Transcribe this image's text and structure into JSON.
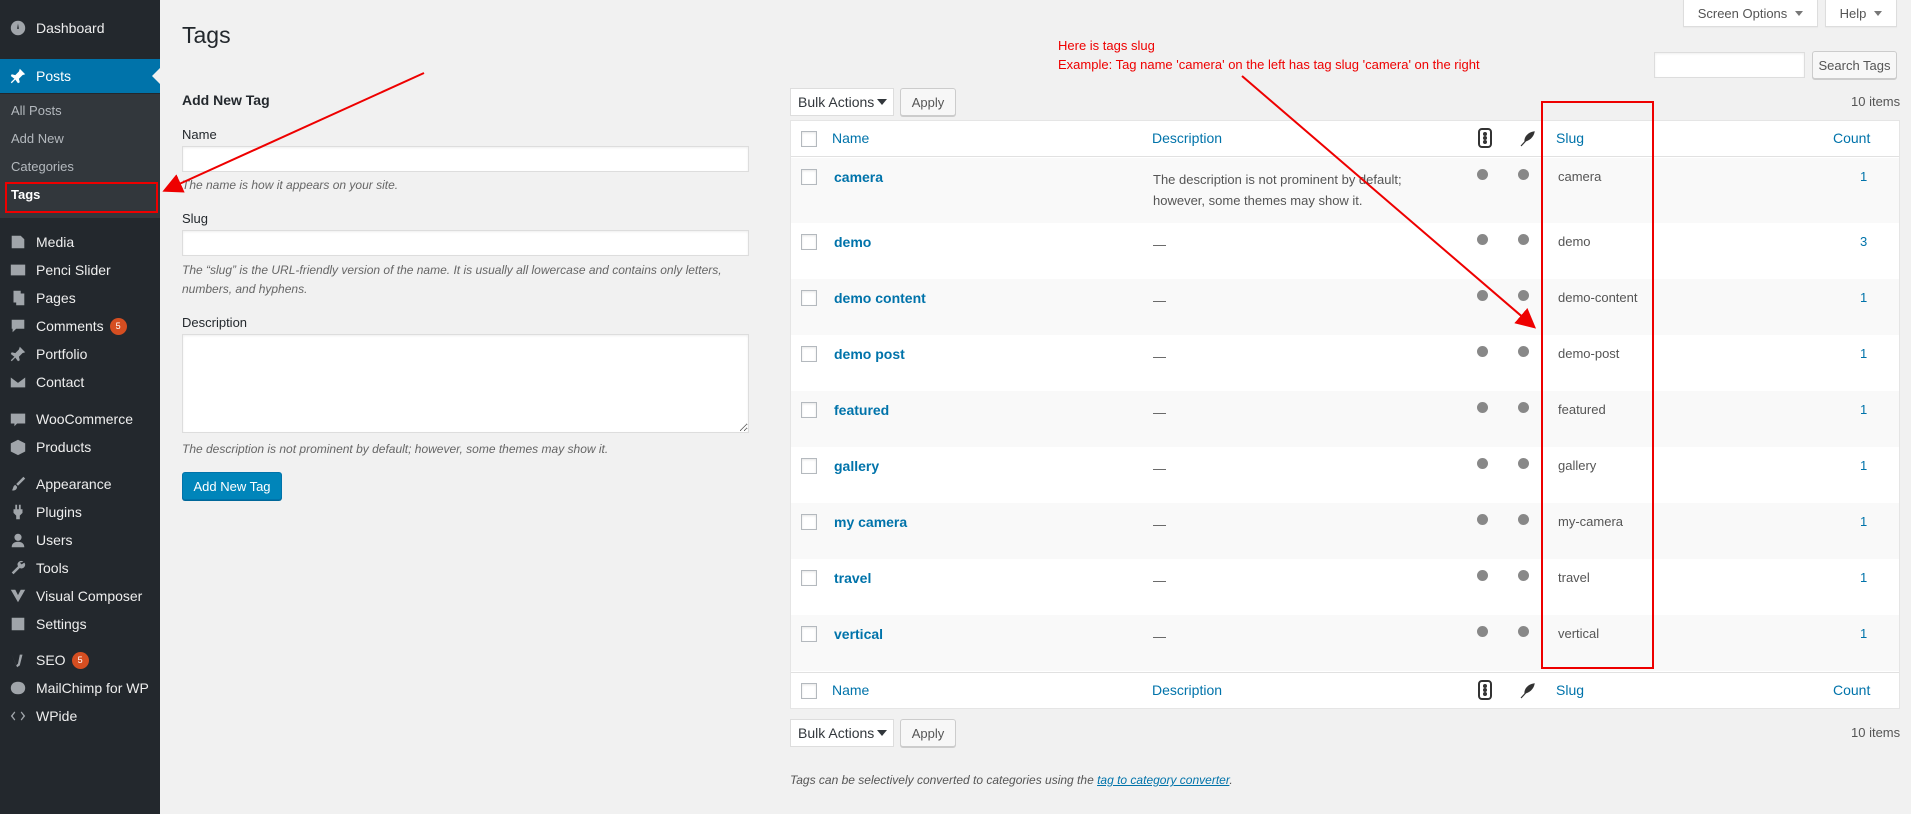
{
  "sidebar": {
    "items": [
      {
        "label": "Dashboard",
        "icon": "dashboard-icon"
      },
      {
        "label": "Posts",
        "icon": "pushpin-icon"
      },
      {
        "label": "Media",
        "icon": "media-icon"
      },
      {
        "label": "Penci Slider",
        "icon": "slider-icon"
      },
      {
        "label": "Pages",
        "icon": "pages-icon"
      },
      {
        "label": "Comments",
        "icon": "comment-icon",
        "badge": "5"
      },
      {
        "label": "Portfolio",
        "icon": "pushpin-icon"
      },
      {
        "label": "Contact",
        "icon": "mail-icon"
      },
      {
        "label": "WooCommerce",
        "icon": "woocommerce-icon"
      },
      {
        "label": "Products",
        "icon": "box-icon"
      },
      {
        "label": "Appearance",
        "icon": "brush-icon"
      },
      {
        "label": "Plugins",
        "icon": "plugin-icon"
      },
      {
        "label": "Users",
        "icon": "users-icon"
      },
      {
        "label": "Tools",
        "icon": "wrench-icon"
      },
      {
        "label": "Visual Composer",
        "icon": "visual-composer-icon"
      },
      {
        "label": "Settings",
        "icon": "settings-icon"
      },
      {
        "label": "SEO",
        "icon": "seo-icon",
        "badge": "5"
      },
      {
        "label": "MailChimp for WP",
        "icon": "mailchimp-icon"
      },
      {
        "label": "WPide",
        "icon": "code-icon"
      }
    ],
    "submenu": [
      "All Posts",
      "Add New",
      "Categories",
      "Tags"
    ]
  },
  "page_title": "Tags",
  "screen_options": "Screen Options",
  "help": "Help",
  "search": {
    "value": "",
    "button": "Search Tags"
  },
  "form": {
    "heading": "Add New Tag",
    "name_label": "Name",
    "name_help": "The name is how it appears on your site.",
    "slug_label": "Slug",
    "slug_help": "The “slug” is the URL-friendly version of the name. It is usually all lowercase and contains only letters, numbers, and hyphens.",
    "desc_label": "Description",
    "desc_help": "The description is not prominent by default; however, some themes may show it.",
    "submit": "Add New Tag"
  },
  "bulk": {
    "label": "Bulk Actions",
    "apply": "Apply",
    "items": "10 items"
  },
  "table": {
    "headers": {
      "name": "Name",
      "description": "Description",
      "slug": "Slug",
      "count": "Count"
    },
    "rows": [
      {
        "name": "camera",
        "description": "The description is not prominent by default; however, some themes may show it.",
        "slug": "camera",
        "count": "1"
      },
      {
        "name": "demo",
        "description": "—",
        "slug": "demo",
        "count": "3"
      },
      {
        "name": "demo content",
        "description": "—",
        "slug": "demo-content",
        "count": "1"
      },
      {
        "name": "demo post",
        "description": "—",
        "slug": "demo-post",
        "count": "1"
      },
      {
        "name": "featured",
        "description": "—",
        "slug": "featured",
        "count": "1"
      },
      {
        "name": "gallery",
        "description": "—",
        "slug": "gallery",
        "count": "1"
      },
      {
        "name": "my camera",
        "description": "—",
        "slug": "my-camera",
        "count": "1"
      },
      {
        "name": "travel",
        "description": "—",
        "slug": "travel",
        "count": "1"
      },
      {
        "name": "vertical",
        "description": "—",
        "slug": "vertical",
        "count": "1"
      }
    ]
  },
  "annotation": {
    "line1": "Here is tags slug",
    "line2": "Example: Tag  name 'camera' on the left has tag slug 'camera' on the right"
  },
  "footer": {
    "text": "Tags can be selectively converted to categories using the ",
    "link": "tag to category converter",
    "end": "."
  },
  "colors": {
    "accent": "#0073aa",
    "sidebar": "#23282d",
    "annotation": "#e00000"
  }
}
